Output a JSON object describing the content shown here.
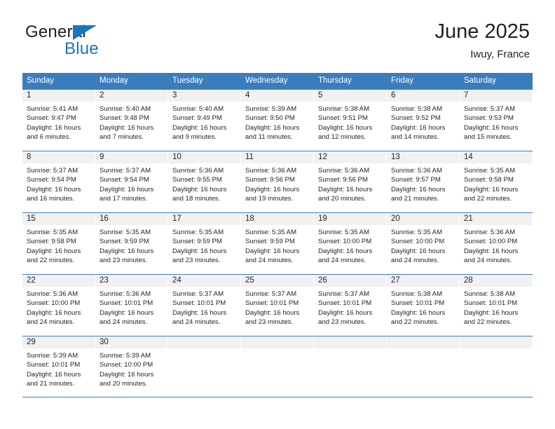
{
  "brand": {
    "name_part1": "General",
    "name_part2": "Blue",
    "triangle_color": "#1b75bb",
    "text_color": "#231f20"
  },
  "header": {
    "title": "June 2025",
    "subtitle": "Iwuy, France"
  },
  "theme": {
    "header_blue": "#3a7dbd",
    "day_band_gray": "#f1f1f1",
    "text": "#231f20",
    "page_background": "#ffffff"
  },
  "weekdays": [
    "Sunday",
    "Monday",
    "Tuesday",
    "Wednesday",
    "Thursday",
    "Friday",
    "Saturday"
  ],
  "weeks": [
    [
      {
        "day": "1",
        "sunrise": "Sunrise: 5:41 AM",
        "sunset": "Sunset: 9:47 PM",
        "daylight1": "Daylight: 16 hours",
        "daylight2": "and 6 minutes."
      },
      {
        "day": "2",
        "sunrise": "Sunrise: 5:40 AM",
        "sunset": "Sunset: 9:48 PM",
        "daylight1": "Daylight: 16 hours",
        "daylight2": "and 7 minutes."
      },
      {
        "day": "3",
        "sunrise": "Sunrise: 5:40 AM",
        "sunset": "Sunset: 9:49 PM",
        "daylight1": "Daylight: 16 hours",
        "daylight2": "and 9 minutes."
      },
      {
        "day": "4",
        "sunrise": "Sunrise: 5:39 AM",
        "sunset": "Sunset: 9:50 PM",
        "daylight1": "Daylight: 16 hours",
        "daylight2": "and 11 minutes."
      },
      {
        "day": "5",
        "sunrise": "Sunrise: 5:38 AM",
        "sunset": "Sunset: 9:51 PM",
        "daylight1": "Daylight: 16 hours",
        "daylight2": "and 12 minutes."
      },
      {
        "day": "6",
        "sunrise": "Sunrise: 5:38 AM",
        "sunset": "Sunset: 9:52 PM",
        "daylight1": "Daylight: 16 hours",
        "daylight2": "and 14 minutes."
      },
      {
        "day": "7",
        "sunrise": "Sunrise: 5:37 AM",
        "sunset": "Sunset: 9:53 PM",
        "daylight1": "Daylight: 16 hours",
        "daylight2": "and 15 minutes."
      }
    ],
    [
      {
        "day": "8",
        "sunrise": "Sunrise: 5:37 AM",
        "sunset": "Sunset: 9:54 PM",
        "daylight1": "Daylight: 16 hours",
        "daylight2": "and 16 minutes."
      },
      {
        "day": "9",
        "sunrise": "Sunrise: 5:37 AM",
        "sunset": "Sunset: 9:54 PM",
        "daylight1": "Daylight: 16 hours",
        "daylight2": "and 17 minutes."
      },
      {
        "day": "10",
        "sunrise": "Sunrise: 5:36 AM",
        "sunset": "Sunset: 9:55 PM",
        "daylight1": "Daylight: 16 hours",
        "daylight2": "and 18 minutes."
      },
      {
        "day": "11",
        "sunrise": "Sunrise: 5:36 AM",
        "sunset": "Sunset: 9:56 PM",
        "daylight1": "Daylight: 16 hours",
        "daylight2": "and 19 minutes."
      },
      {
        "day": "12",
        "sunrise": "Sunrise: 5:36 AM",
        "sunset": "Sunset: 9:56 PM",
        "daylight1": "Daylight: 16 hours",
        "daylight2": "and 20 minutes."
      },
      {
        "day": "13",
        "sunrise": "Sunrise: 5:36 AM",
        "sunset": "Sunset: 9:57 PM",
        "daylight1": "Daylight: 16 hours",
        "daylight2": "and 21 minutes."
      },
      {
        "day": "14",
        "sunrise": "Sunrise: 5:35 AM",
        "sunset": "Sunset: 9:58 PM",
        "daylight1": "Daylight: 16 hours",
        "daylight2": "and 22 minutes."
      }
    ],
    [
      {
        "day": "15",
        "sunrise": "Sunrise: 5:35 AM",
        "sunset": "Sunset: 9:58 PM",
        "daylight1": "Daylight: 16 hours",
        "daylight2": "and 22 minutes."
      },
      {
        "day": "16",
        "sunrise": "Sunrise: 5:35 AM",
        "sunset": "Sunset: 9:59 PM",
        "daylight1": "Daylight: 16 hours",
        "daylight2": "and 23 minutes."
      },
      {
        "day": "17",
        "sunrise": "Sunrise: 5:35 AM",
        "sunset": "Sunset: 9:59 PM",
        "daylight1": "Daylight: 16 hours",
        "daylight2": "and 23 minutes."
      },
      {
        "day": "18",
        "sunrise": "Sunrise: 5:35 AM",
        "sunset": "Sunset: 9:59 PM",
        "daylight1": "Daylight: 16 hours",
        "daylight2": "and 24 minutes."
      },
      {
        "day": "19",
        "sunrise": "Sunrise: 5:35 AM",
        "sunset": "Sunset: 10:00 PM",
        "daylight1": "Daylight: 16 hours",
        "daylight2": "and 24 minutes."
      },
      {
        "day": "20",
        "sunrise": "Sunrise: 5:35 AM",
        "sunset": "Sunset: 10:00 PM",
        "daylight1": "Daylight: 16 hours",
        "daylight2": "and 24 minutes."
      },
      {
        "day": "21",
        "sunrise": "Sunrise: 5:36 AM",
        "sunset": "Sunset: 10:00 PM",
        "daylight1": "Daylight: 16 hours",
        "daylight2": "and 24 minutes."
      }
    ],
    [
      {
        "day": "22",
        "sunrise": "Sunrise: 5:36 AM",
        "sunset": "Sunset: 10:00 PM",
        "daylight1": "Daylight: 16 hours",
        "daylight2": "and 24 minutes."
      },
      {
        "day": "23",
        "sunrise": "Sunrise: 5:36 AM",
        "sunset": "Sunset: 10:01 PM",
        "daylight1": "Daylight: 16 hours",
        "daylight2": "and 24 minutes."
      },
      {
        "day": "24",
        "sunrise": "Sunrise: 5:37 AM",
        "sunset": "Sunset: 10:01 PM",
        "daylight1": "Daylight: 16 hours",
        "daylight2": "and 24 minutes."
      },
      {
        "day": "25",
        "sunrise": "Sunrise: 5:37 AM",
        "sunset": "Sunset: 10:01 PM",
        "daylight1": "Daylight: 16 hours",
        "daylight2": "and 23 minutes."
      },
      {
        "day": "26",
        "sunrise": "Sunrise: 5:37 AM",
        "sunset": "Sunset: 10:01 PM",
        "daylight1": "Daylight: 16 hours",
        "daylight2": "and 23 minutes."
      },
      {
        "day": "27",
        "sunrise": "Sunrise: 5:38 AM",
        "sunset": "Sunset: 10:01 PM",
        "daylight1": "Daylight: 16 hours",
        "daylight2": "and 22 minutes."
      },
      {
        "day": "28",
        "sunrise": "Sunrise: 5:38 AM",
        "sunset": "Sunset: 10:01 PM",
        "daylight1": "Daylight: 16 hours",
        "daylight2": "and 22 minutes."
      }
    ],
    [
      {
        "day": "29",
        "sunrise": "Sunrise: 5:39 AM",
        "sunset": "Sunset: 10:01 PM",
        "daylight1": "Daylight: 16 hours",
        "daylight2": "and 21 minutes."
      },
      {
        "day": "30",
        "sunrise": "Sunrise: 5:39 AM",
        "sunset": "Sunset: 10:00 PM",
        "daylight1": "Daylight: 16 hours",
        "daylight2": "and 20 minutes."
      },
      {
        "day": "",
        "sunrise": "",
        "sunset": "",
        "daylight1": "",
        "daylight2": ""
      },
      {
        "day": "",
        "sunrise": "",
        "sunset": "",
        "daylight1": "",
        "daylight2": ""
      },
      {
        "day": "",
        "sunrise": "",
        "sunset": "",
        "daylight1": "",
        "daylight2": ""
      },
      {
        "day": "",
        "sunrise": "",
        "sunset": "",
        "daylight1": "",
        "daylight2": ""
      },
      {
        "day": "",
        "sunrise": "",
        "sunset": "",
        "daylight1": "",
        "daylight2": ""
      }
    ]
  ]
}
